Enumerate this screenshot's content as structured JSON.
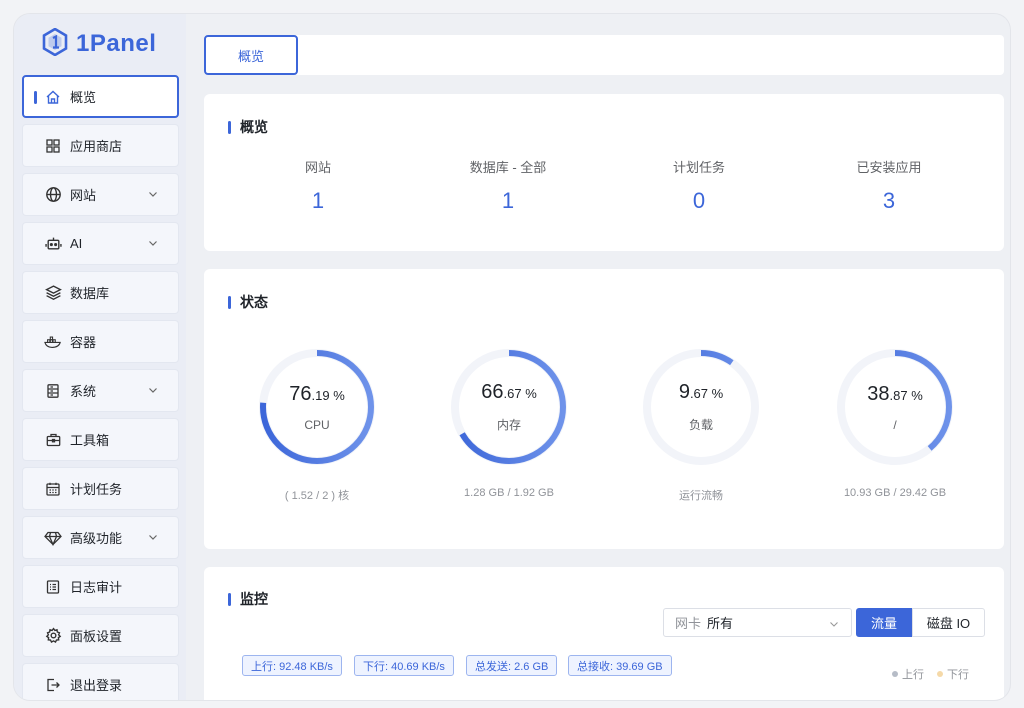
{
  "app": {
    "name": "1Panel",
    "brand_color": "#3c66d9"
  },
  "sidebar": {
    "items": [
      {
        "label": "概览",
        "icon": "home-icon",
        "active": true
      },
      {
        "label": "应用商店",
        "icon": "grid-icon"
      },
      {
        "label": "网站",
        "icon": "globe-icon",
        "expandable": true
      },
      {
        "label": "AI",
        "icon": "robot-icon",
        "expandable": true
      },
      {
        "label": "数据库",
        "icon": "layers-icon"
      },
      {
        "label": "容器",
        "icon": "docker-icon"
      },
      {
        "label": "系统",
        "icon": "server-icon",
        "expandable": true
      },
      {
        "label": "工具箱",
        "icon": "toolbox-icon"
      },
      {
        "label": "计划任务",
        "icon": "calendar-icon"
      },
      {
        "label": "高级功能",
        "icon": "diamond-icon",
        "expandable": true
      },
      {
        "label": "日志审计",
        "icon": "log-icon"
      },
      {
        "label": "面板设置",
        "icon": "gear-icon"
      },
      {
        "label": "退出登录",
        "icon": "logout-icon"
      }
    ]
  },
  "tabs": [
    {
      "label": "概览",
      "active": true
    }
  ],
  "overview": {
    "title": "概览",
    "stats": [
      {
        "label": "网站",
        "value": "1"
      },
      {
        "label": "数据库 - 全部",
        "value": "1"
      },
      {
        "label": "计划任务",
        "value": "0"
      },
      {
        "label": "已安装应用",
        "value": "3"
      }
    ]
  },
  "status": {
    "title": "状态",
    "gauges": [
      {
        "int": "76",
        "dec": ".19",
        "unit": " %",
        "label": "CPU",
        "footer": "( 1.52 / 2 ) 核",
        "percent": 76.19
      },
      {
        "int": "66",
        "dec": ".67",
        "unit": " %",
        "label": "内存",
        "footer": "1.28 GB / 1.92 GB",
        "percent": 66.67
      },
      {
        "int": "9",
        "dec": ".67",
        "unit": " %",
        "label": "负载",
        "footer": "运行流畅",
        "percent": 9.67
      },
      {
        "int": "38",
        "dec": ".87",
        "unit": " %",
        "label": "/",
        "footer": "10.93 GB / 29.42 GB",
        "percent": 38.87
      }
    ]
  },
  "monitor": {
    "title": "监控",
    "nic_prefix": "网卡",
    "nic_value": "所有",
    "seg_traffic": "流量",
    "seg_disk": "磁盘 IO",
    "pills": [
      "上行: 92.48 KB/s",
      "下行: 40.69 KB/s",
      "总发送: 2.6 GB",
      "总接收: 39.69 GB"
    ],
    "legend_up": "上行",
    "legend_down": "下行"
  }
}
